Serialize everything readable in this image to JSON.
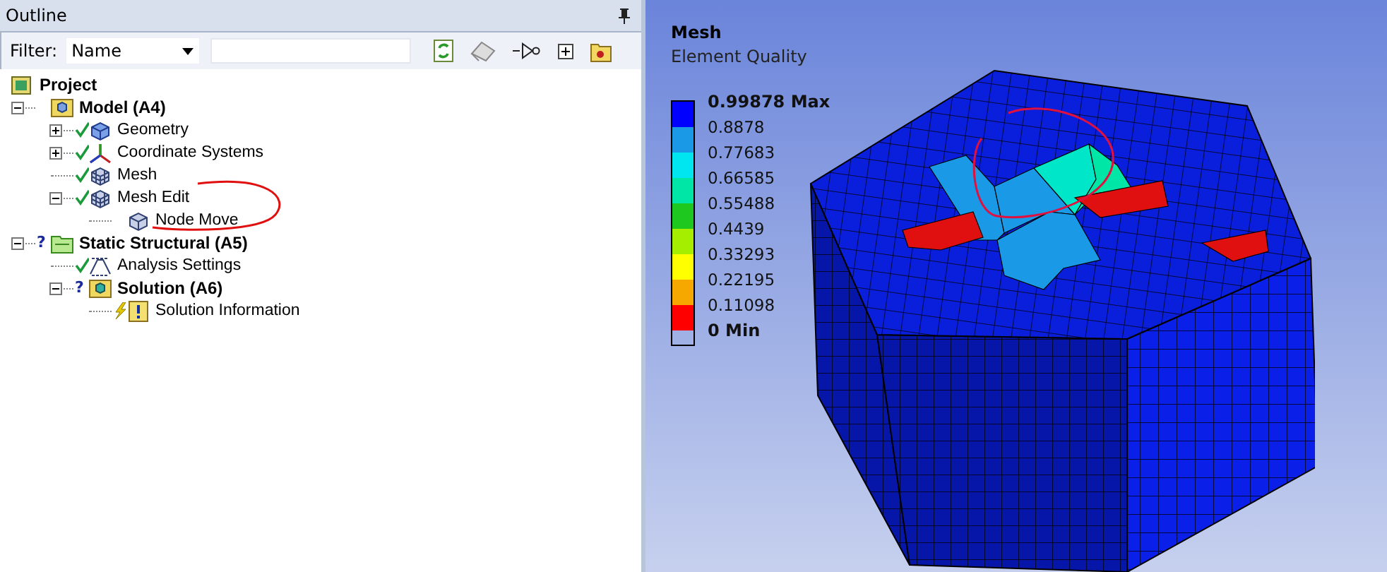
{
  "outline": {
    "title": "Outline",
    "filter": {
      "label": "Filter:",
      "value": "Name"
    },
    "tree": [
      {
        "label": "Project",
        "kind": "project",
        "children": [
          {
            "label": "Model (A4)",
            "kind": "model",
            "expanded": true,
            "children": [
              {
                "label": "Geometry",
                "kind": "geometry",
                "status": {
                  "kind": "check"
                },
                "expanded": false
              },
              {
                "label": "Coordinate Systems",
                "kind": "coordinates",
                "status": {
                  "kind": "check"
                },
                "expanded": false
              },
              {
                "label": "Mesh",
                "kind": "mesh",
                "status": {
                  "kind": "check"
                }
              },
              {
                "label": "Mesh Edit",
                "kind": "mesh",
                "status": {
                  "kind": "check"
                },
                "expanded": true,
                "children": [
                  {
                    "label": "Node Move",
                    "kind": "node-move"
                  }
                ]
              }
            ]
          },
          {
            "label": "Static Structural (A5)",
            "kind": "analysis",
            "status": {
              "kind": "question",
              "glyph": "?"
            },
            "expanded": true,
            "children": [
              {
                "label": "Analysis Settings",
                "kind": "settings",
                "status": {
                  "kind": "check"
                }
              },
              {
                "label": "Solution (A6)",
                "kind": "solution",
                "status": {
                  "kind": "question",
                  "glyph": "?"
                },
                "expanded": true,
                "children": [
                  {
                    "label": "Solution Information",
                    "kind": "info",
                    "status": {
                      "kind": "lightning"
                    }
                  }
                ]
              }
            ]
          }
        ]
      }
    ]
  },
  "viewport": {
    "title": "Mesh",
    "subtitle": "Element Quality",
    "legend": {
      "labels": [
        "0.99878 Max",
        "0.8878",
        "0.77683",
        "0.66585",
        "0.55488",
        "0.4439",
        "0.33293",
        "0.22195",
        "0.11098",
        "0 Min"
      ],
      "bands": [
        {
          "color": "#0000ff"
        },
        {
          "color": "#1a9ae6"
        },
        {
          "color": "#00e6f0"
        },
        {
          "color": "#00e6a6"
        },
        {
          "color": "#1ec81e"
        },
        {
          "color": "#a6ee00"
        },
        {
          "color": "#ffff00"
        },
        {
          "color": "#f6a800"
        },
        {
          "color": "#ff0000"
        }
      ]
    }
  }
}
